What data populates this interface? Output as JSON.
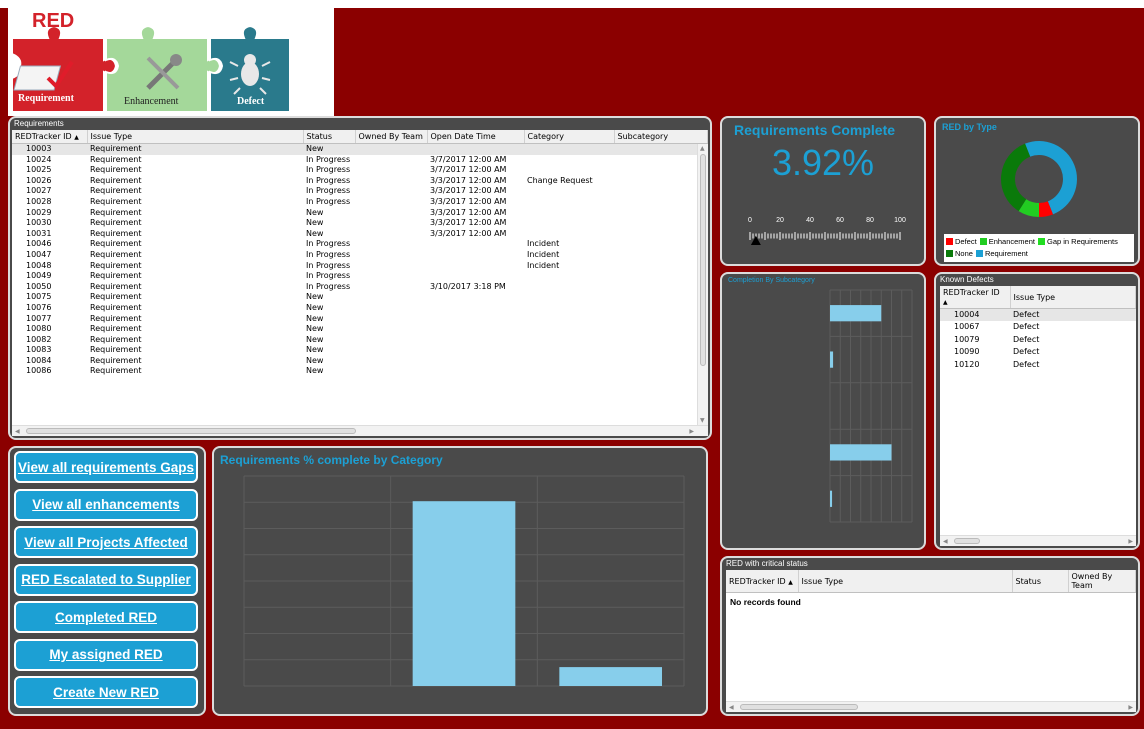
{
  "logo": {
    "title": "RED",
    "pieces": [
      "Requirement",
      "Enhancement",
      "Defect"
    ]
  },
  "requirements": {
    "title": "Requirements",
    "columns": [
      "REDTracker ID",
      "Issue Type",
      "Status",
      "Owned By Team",
      "Open Date Time",
      "Category",
      "Subcategory"
    ],
    "rows": [
      [
        "10003",
        "Requirement",
        "New",
        "",
        "",
        "",
        ""
      ],
      [
        "10024",
        "Requirement",
        "In Progress",
        "",
        "3/7/2017 12:00 AM",
        "",
        ""
      ],
      [
        "10025",
        "Requirement",
        "In Progress",
        "",
        "3/7/2017 12:00 AM",
        "",
        ""
      ],
      [
        "10026",
        "Requirement",
        "In Progress",
        "",
        "3/3/2017 12:00 AM",
        "Change Request",
        ""
      ],
      [
        "10027",
        "Requirement",
        "In Progress",
        "",
        "3/3/2017 12:00 AM",
        "",
        ""
      ],
      [
        "10028",
        "Requirement",
        "In Progress",
        "",
        "3/3/2017 12:00 AM",
        "",
        ""
      ],
      [
        "10029",
        "Requirement",
        "New",
        "",
        "3/3/2017 12:00 AM",
        "",
        ""
      ],
      [
        "10030",
        "Requirement",
        "New",
        "",
        "3/3/2017 12:00 AM",
        "",
        ""
      ],
      [
        "10031",
        "Requirement",
        "New",
        "",
        "3/3/2017 12:00 AM",
        "",
        ""
      ],
      [
        "10046",
        "Requirement",
        "In Progress",
        "",
        "",
        "Incident",
        ""
      ],
      [
        "10047",
        "Requirement",
        "In Progress",
        "",
        "",
        "Incident",
        ""
      ],
      [
        "10048",
        "Requirement",
        "In Progress",
        "",
        "",
        "Incident",
        ""
      ],
      [
        "10049",
        "Requirement",
        "In Progress",
        "",
        "",
        "",
        ""
      ],
      [
        "10050",
        "Requirement",
        "In Progress",
        "",
        "3/10/2017 3:18 PM",
        "",
        ""
      ],
      [
        "10075",
        "Requirement",
        "New",
        "",
        "",
        "",
        ""
      ],
      [
        "10076",
        "Requirement",
        "New",
        "",
        "",
        "",
        ""
      ],
      [
        "10077",
        "Requirement",
        "New",
        "",
        "",
        "",
        ""
      ],
      [
        "10080",
        "Requirement",
        "New",
        "",
        "",
        "",
        ""
      ],
      [
        "10082",
        "Requirement",
        "New",
        "",
        "",
        "",
        ""
      ],
      [
        "10083",
        "Requirement",
        "New",
        "",
        "",
        "",
        ""
      ],
      [
        "10084",
        "Requirement",
        "New",
        "",
        "",
        "",
        ""
      ],
      [
        "10086",
        "Requirement",
        "New",
        "",
        "",
        "",
        ""
      ]
    ]
  },
  "req_complete": {
    "title": "Requirements Complete",
    "value": "3.92%",
    "gauge_ticks": [
      "0",
      "20",
      "40",
      "60",
      "80",
      "100"
    ],
    "gauge_value": 3.92
  },
  "red_by_type": {
    "title": "RED by Type",
    "legend": [
      {
        "label": "Defect",
        "color": "#ff0000"
      },
      {
        "label": "Enhancement",
        "color": "#22cc22"
      },
      {
        "label": "Gap in Requirements",
        "color": "#22dd22"
      },
      {
        "label": "None",
        "color": "#0a7a0a"
      },
      {
        "label": "Requirement",
        "color": "#1ca0d4"
      }
    ]
  },
  "completion_by_subcategory": {
    "title": "Completion By Subcategory"
  },
  "known_defects": {
    "title": "Known Defects",
    "columns": [
      "REDTracker ID",
      "Issue Type"
    ],
    "rows": [
      [
        "10004",
        "Defect"
      ],
      [
        "10067",
        "Defect"
      ],
      [
        "10079",
        "Defect"
      ],
      [
        "10090",
        "Defect"
      ],
      [
        "10120",
        "Defect"
      ]
    ]
  },
  "critical": {
    "title": "RED with critical status",
    "columns": [
      "REDTracker ID",
      "Issue Type",
      "Status",
      "Owned By Team"
    ],
    "empty_text": "No records found"
  },
  "buttons": [
    "View all requirements Gaps",
    "View all enhancements",
    "View all Projects Affected",
    "RED Escalated to Supplier",
    "Completed RED",
    "My assigned RED",
    "Create New RED"
  ],
  "chart_data": [
    {
      "type": "bar",
      "title": "Requirements % complete by Category",
      "categories": [
        "",
        "",
        ""
      ],
      "values": [
        0,
        88,
        9
      ],
      "ylim": [
        0,
        100
      ],
      "color": "#87ceeb"
    },
    {
      "type": "bar",
      "orientation": "horizontal",
      "title": "Completion By Subcategory",
      "values": [
        50,
        3,
        0,
        60,
        2
      ],
      "xlim": [
        0,
        80
      ],
      "color": "#87ceeb"
    },
    {
      "type": "pie",
      "title": "RED by Type",
      "categories": [
        "Defect",
        "Enhancement",
        "Gap in Requirements",
        "None",
        "Requirement"
      ],
      "values": [
        6,
        9,
        0,
        35,
        50
      ]
    }
  ]
}
